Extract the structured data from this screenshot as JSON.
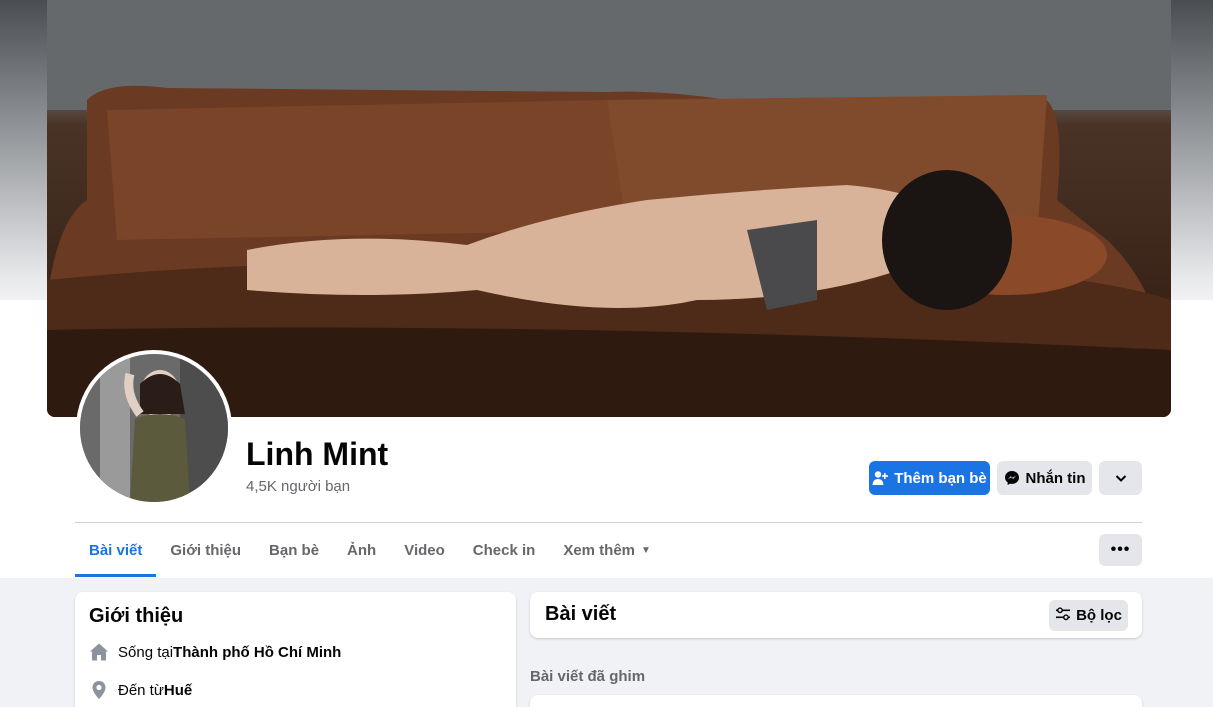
{
  "profile": {
    "name": "Linh Mint",
    "friend_count": "4,5K người bạn"
  },
  "actions": {
    "add_friend_label": "Thêm bạn bè",
    "message_label": "Nhắn tin"
  },
  "tabs": [
    {
      "label": "Bài viết",
      "active": true
    },
    {
      "label": "Giới thiệu",
      "active": false
    },
    {
      "label": "Bạn bè",
      "active": false
    },
    {
      "label": "Ảnh",
      "active": false
    },
    {
      "label": "Video",
      "active": false
    },
    {
      "label": "Check in",
      "active": false
    },
    {
      "label": "Xem thêm",
      "active": false
    }
  ],
  "intro": {
    "title": "Giới thiệu",
    "lives_in_prefix": "Sống tại ",
    "lives_in_value": "Thành phố Hồ Chí Minh",
    "from_prefix": "Đến từ ",
    "from_value": "Huế"
  },
  "posts": {
    "title": "Bài viết",
    "filter_label": "Bộ lọc",
    "pinned_label": "Bài viết đã ghim"
  },
  "colors": {
    "accent": "#1b74e4",
    "secondary_button": "#e4e6eb",
    "page_background": "#f0f2f5"
  },
  "icons": [
    "add-friend-icon",
    "messenger-icon",
    "chevron-down-icon",
    "more-dots-icon",
    "home-icon",
    "location-pin-icon",
    "filter-icon"
  ]
}
